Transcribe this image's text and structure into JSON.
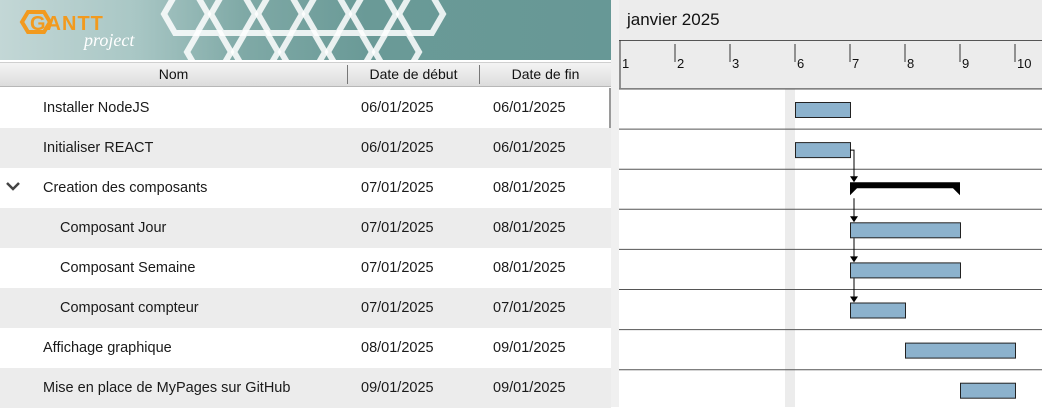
{
  "logo": {
    "brand": "GANTT",
    "sub": "project"
  },
  "columns": {
    "name": "Nom",
    "start": "Date de début",
    "end": "Date de fin"
  },
  "tasks": [
    {
      "name": "Installer NodeJS",
      "start": "06/01/2025",
      "end": "06/01/2025",
      "indent": 0,
      "expandable": false,
      "day_start": 6,
      "day_end": 7,
      "type": "task"
    },
    {
      "name": "Initialiser REACT",
      "start": "06/01/2025",
      "end": "06/01/2025",
      "indent": 0,
      "expandable": false,
      "day_start": 6,
      "day_end": 7,
      "type": "task"
    },
    {
      "name": "Creation des composants",
      "start": "07/01/2025",
      "end": "08/01/2025",
      "indent": 0,
      "expandable": true,
      "day_start": 7,
      "day_end": 9,
      "type": "summary"
    },
    {
      "name": "Composant Jour",
      "start": "07/01/2025",
      "end": "08/01/2025",
      "indent": 1,
      "expandable": false,
      "day_start": 7,
      "day_end": 9,
      "type": "task"
    },
    {
      "name": "Composant Semaine",
      "start": "07/01/2025",
      "end": "08/01/2025",
      "indent": 1,
      "expandable": false,
      "day_start": 7,
      "day_end": 9,
      "type": "task"
    },
    {
      "name": "Composant compteur",
      "start": "07/01/2025",
      "end": "07/01/2025",
      "indent": 1,
      "expandable": false,
      "day_start": 7,
      "day_end": 8,
      "type": "task"
    },
    {
      "name": "Affichage graphique",
      "start": "08/01/2025",
      "end": "09/01/2025",
      "indent": 0,
      "expandable": false,
      "day_start": 8,
      "day_end": 10,
      "type": "task"
    },
    {
      "name": "Mise en place de MyPages sur GitHub",
      "start": "09/01/2025",
      "end": "09/01/2025",
      "indent": 0,
      "expandable": false,
      "day_start": 9,
      "day_end": 10,
      "type": "task"
    }
  ],
  "timeline": {
    "month": "janvier 2025",
    "days": [
      "1",
      "2",
      "3",
      "6",
      "7",
      "8",
      "9",
      "10"
    ],
    "weekend_after": "3"
  },
  "colors": {
    "task_fill": "#8cb2cd",
    "task_stroke": "#222222",
    "summary": "#000000",
    "row_alt": "#ececec"
  }
}
